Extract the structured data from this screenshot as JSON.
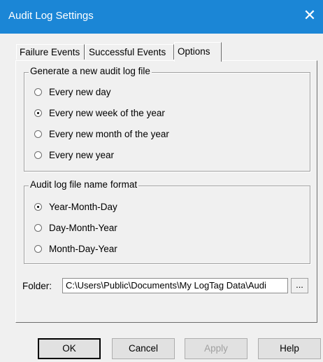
{
  "window": {
    "title": "Audit Log Settings",
    "close_glyph": "✕"
  },
  "tabs": [
    {
      "label": "Failure Events",
      "active": false
    },
    {
      "label": "Successful Events",
      "active": false
    },
    {
      "label": "Options",
      "active": true
    }
  ],
  "group_file": {
    "legend": "Generate a new audit log file",
    "options": [
      {
        "label": "Every new day",
        "checked": false
      },
      {
        "label": "Every new week of the year",
        "checked": true
      },
      {
        "label": "Every new month of the year",
        "checked": false
      },
      {
        "label": "Every new year",
        "checked": false
      }
    ]
  },
  "group_format": {
    "legend": "Audit log file name format",
    "options": [
      {
        "label": "Year-Month-Day",
        "checked": true
      },
      {
        "label": "Day-Month-Year",
        "checked": false
      },
      {
        "label": "Month-Day-Year",
        "checked": false
      }
    ]
  },
  "folder": {
    "label": "Folder:",
    "value": "C:\\Users\\Public\\Documents\\My LogTag Data\\Audi",
    "browse_label": "..."
  },
  "buttons": {
    "ok": "OK",
    "cancel": "Cancel",
    "apply": "Apply",
    "help": "Help"
  },
  "colors": {
    "titlebar": "#1b86d6",
    "dialog_bg": "#f0f0f0"
  }
}
